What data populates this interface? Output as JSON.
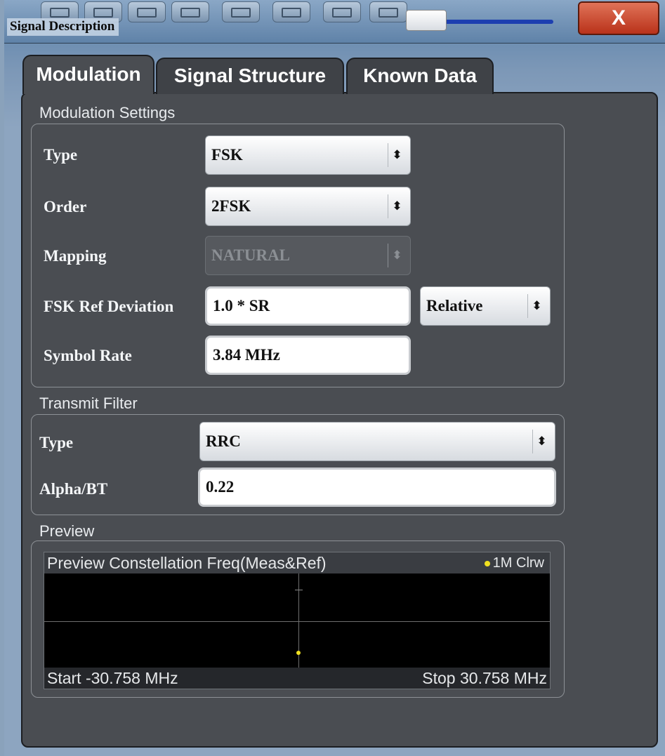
{
  "window": {
    "title": "Signal Description",
    "close_label": "X"
  },
  "tabs": [
    {
      "label": "Modulation",
      "active": true
    },
    {
      "label": "Signal Structure",
      "active": false
    },
    {
      "label": "Known Data",
      "active": false
    }
  ],
  "modulation_settings": {
    "title": "Modulation Settings",
    "type_label": "Type",
    "type_value": "FSK",
    "order_label": "Order",
    "order_value": "2FSK",
    "mapping_label": "Mapping",
    "mapping_value": "NATURAL",
    "fsk_ref_dev_label": "FSK Ref Deviation",
    "fsk_ref_dev_value": "1.0 * SR",
    "fsk_ref_dev_mode": "Relative",
    "symbol_rate_label": "Symbol Rate",
    "symbol_rate_value": "3.84 MHz"
  },
  "transmit_filter": {
    "title": "Transmit Filter",
    "type_label": "Type",
    "type_value": "RRC",
    "alpha_label": "Alpha/BT",
    "alpha_value": "0.22"
  },
  "preview": {
    "title": "Preview",
    "plot_title": "Preview Constellation Freq(Meas&Ref)",
    "trace_label": "1M Clrw",
    "start_label": "Start -30.758 MHz",
    "stop_label": "Stop 30.758 MHz"
  },
  "colors": {
    "trace": "#f0e020",
    "panel": "#4a4d52",
    "close_button": "#c8442a"
  }
}
